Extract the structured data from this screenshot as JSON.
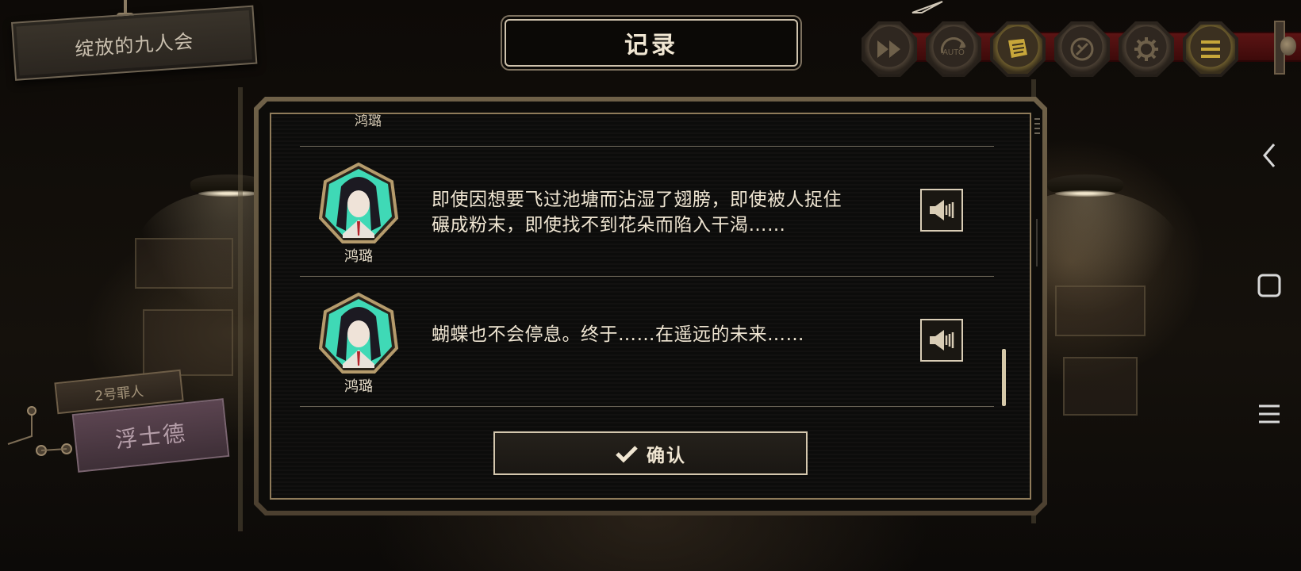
{
  "chapter": {
    "title": "绽放的九人会"
  },
  "character_plate": {
    "tag": "2号罪人",
    "name": "浮士德"
  },
  "toolbar": {
    "buttons": [
      {
        "name": "fast-forward",
        "icon": "fast-forward-icon"
      },
      {
        "name": "auto",
        "icon": "auto-icon",
        "label": "AUTO"
      },
      {
        "name": "log",
        "icon": "log-icon"
      },
      {
        "name": "skip",
        "icon": "skip-icon"
      },
      {
        "name": "settings",
        "icon": "gear-icon"
      },
      {
        "name": "menu",
        "icon": "menu-icon"
      }
    ]
  },
  "modal": {
    "title": "记录",
    "cut_off_speaker": "鸿璐",
    "entries": [
      {
        "speaker": "鸿璐",
        "text": "即使因想要飞过池塘而沾湿了翅膀，即使被人捉住\n碾成粉末，即使找不到花朵而陷入干渴……",
        "icon": "speaker-icon"
      },
      {
        "speaker": "鸿璐",
        "text": "蝴蝶也不会停息。终于……在遥远的未来……",
        "icon": "speaker-icon"
      }
    ],
    "confirm_label": "确认"
  },
  "android_nav": {
    "back": "back-icon",
    "home": "home-icon",
    "recents": "menu-icon"
  },
  "colors": {
    "accent": "#d4c7ae",
    "portrait_bg": "#3fd9b6",
    "toolbar_rail": "#5c1414"
  }
}
